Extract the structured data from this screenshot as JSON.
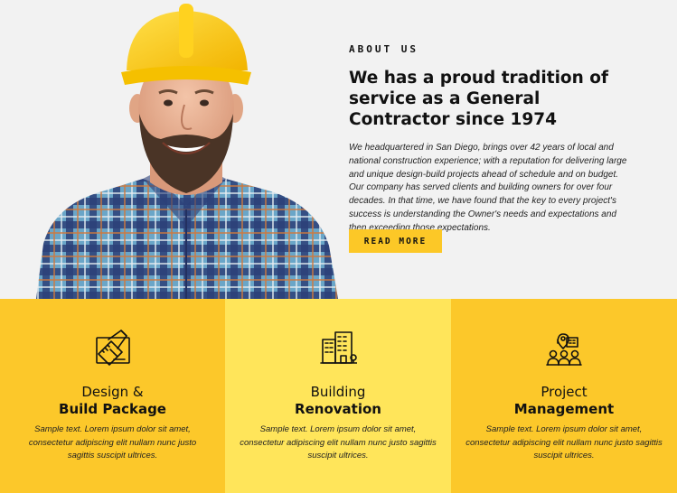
{
  "about": {
    "eyebrow": "ABOUT US",
    "headline": "We has a proud tradition of service as a General Contractor since 1974",
    "body": "We headquartered in San Diego, brings over 42 years of local and national construction experience; with a reputation for delivering large and unique design-build projects ahead of schedule and on budget.  Our company has served clients and building owners for over four decades. In that time, we have found that the key to every project's success is understanding the Owner's needs and expectations and then exceeding those expectations.",
    "button_label": "READ MORE"
  },
  "colors": {
    "accent": "#fcc827",
    "accent_light": "#ffe55a",
    "background": "#f2f2f2"
  },
  "features": [
    {
      "icon": "ruler-pencil-icon",
      "title_line1": "Design &",
      "title_line2": "Build Package",
      "description": "Sample text. Lorem ipsum dolor sit amet, consectetur adipiscing elit nullam nunc justo sagittis suscipit ultrices."
    },
    {
      "icon": "buildings-icon",
      "title_line1": "Building",
      "title_line2": "Renovation",
      "description": "Sample text. Lorem ipsum dolor sit amet, consectetur adipiscing elit nullam nunc justo sagittis suscipit ultrices."
    },
    {
      "icon": "team-location-icon",
      "title_line1": "Project",
      "title_line2": "Management",
      "description": "Sample text. Lorem ipsum dolor sit amet, consectetur adipiscing elit nullam nunc justo sagittis suscipit ultrices."
    }
  ]
}
